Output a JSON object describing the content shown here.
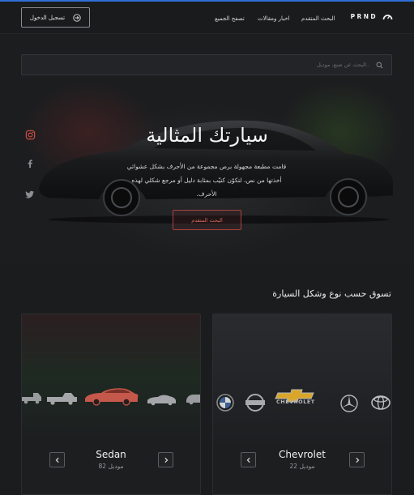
{
  "header": {
    "logo_text": "PRND",
    "nav": [
      "البحث المتقدم",
      "اخبار ومقالات",
      "تصفح الجميع"
    ],
    "login_label": "تسجيل الدخول"
  },
  "hero": {
    "search_placeholder": "البحث عن صنع، موديل..",
    "title": "سيارتك المثالية",
    "description": "قامت مطبعة مجهولة برص مجموعة من الأحرف بشكل عشوائي أخذتها من نص، لتكوّن كتيّب بمثابة دليل أو مرجع شكلي لهذه الأحرف.",
    "button_label": "البحث المتقدم",
    "socials": [
      "instagram-icon",
      "facebook-icon",
      "twitter-icon"
    ]
  },
  "section": {
    "title": "تسوق حسب نوع  وشكل السيارة"
  },
  "cards": [
    {
      "name": "Sedan",
      "count": "82 موديل"
    },
    {
      "name": "Chevrolet",
      "count": "22 موديل"
    }
  ],
  "brands": [
    "bmw-logo",
    "nissan-logo",
    "chevrolet-logo",
    "mercedes-logo",
    "toyota-logo"
  ],
  "brand_text": "CHEVROLET",
  "colors": {
    "accent_red": "#a8433d",
    "accent_blue": "#2f6fd6",
    "background": "#1b1c1e"
  }
}
